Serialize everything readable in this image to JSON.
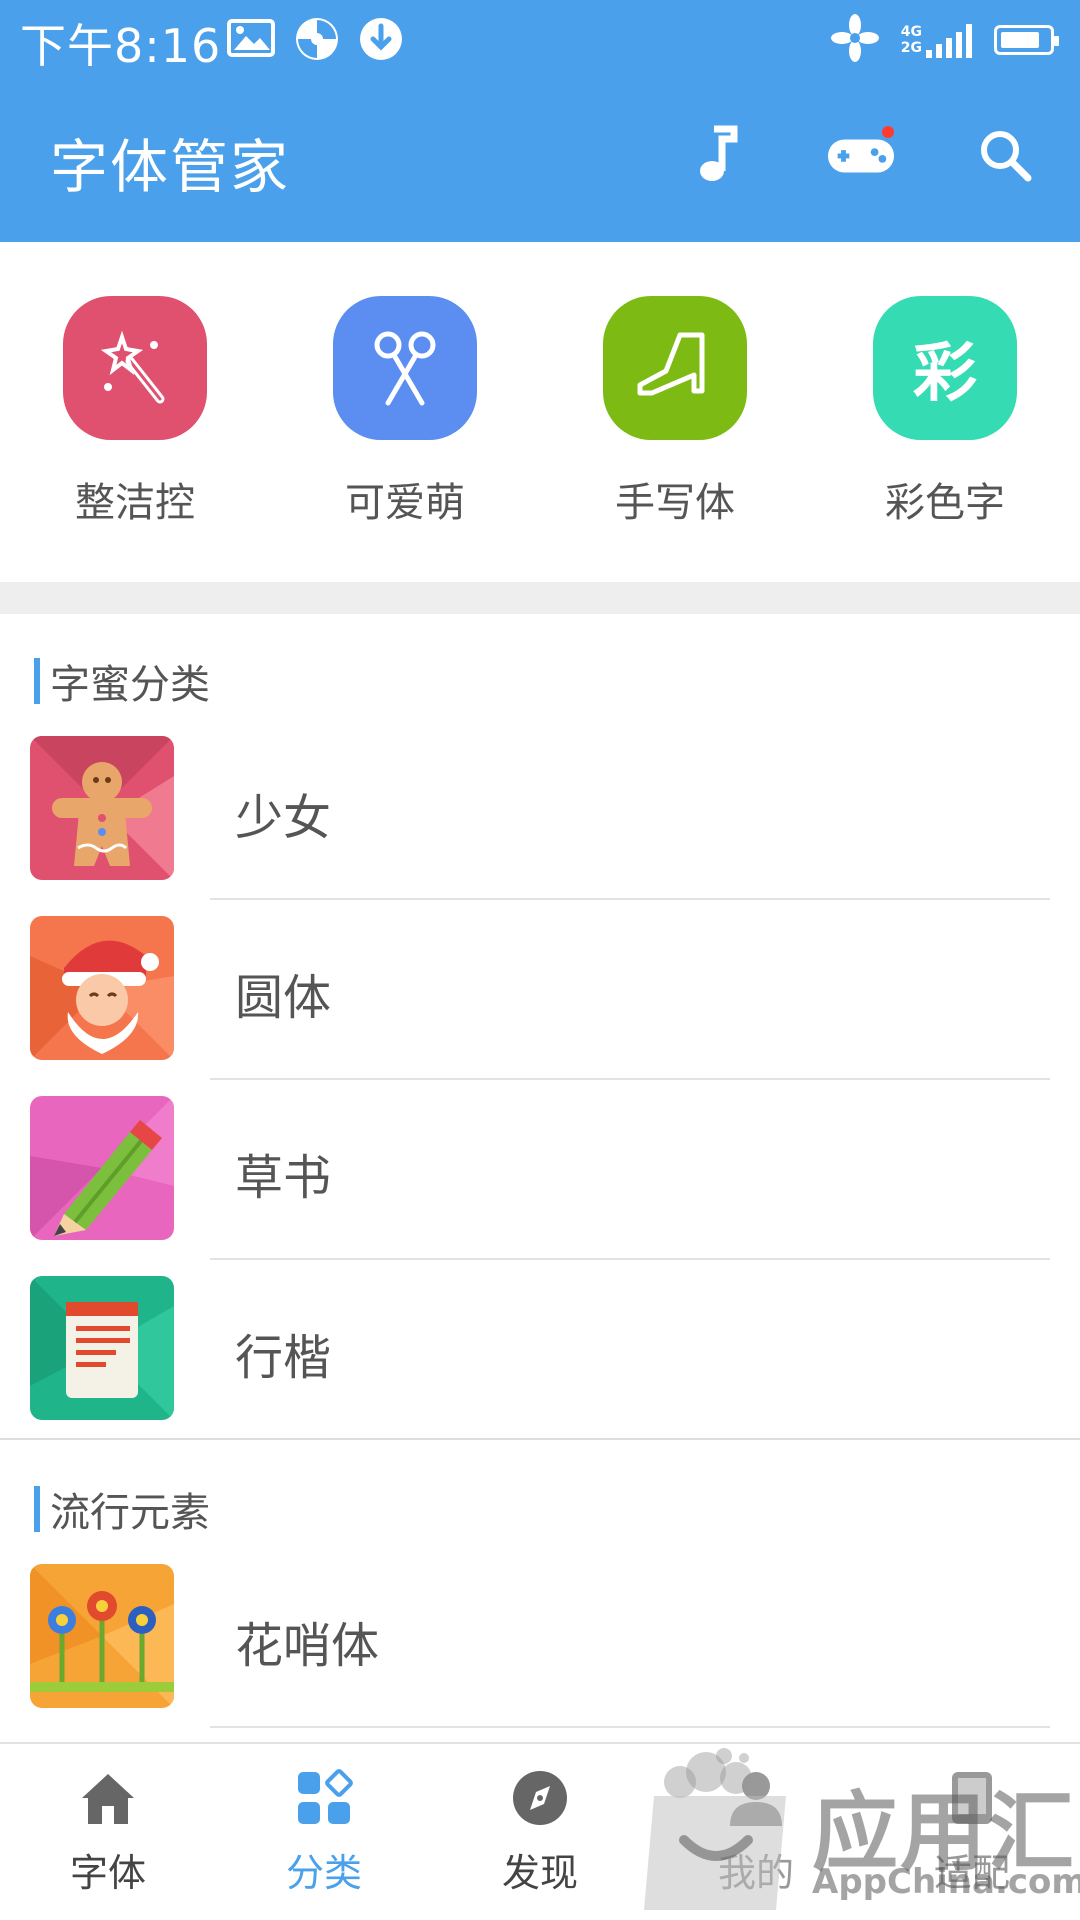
{
  "status_bar": {
    "time": "下午8:16",
    "network_top": "4G",
    "network_bottom": "2G"
  },
  "header": {
    "title": "字体管家",
    "icons": [
      "music-note-icon",
      "gamepad-icon",
      "search-icon"
    ]
  },
  "featured_categories": [
    {
      "label": "整洁控",
      "icon": "magic-wand-icon",
      "color": "#e0506f"
    },
    {
      "label": "可爱萌",
      "icon": "scissors-icon",
      "color": "#5b8ef0"
    },
    {
      "label": "手写体",
      "icon": "high-heel-icon",
      "color": "#7dbb14"
    },
    {
      "label": "彩色字",
      "icon": "colorful-char-icon",
      "icon_text": "彩",
      "color": "#35dbb2"
    }
  ],
  "sections": [
    {
      "title": "字蜜分类",
      "items": [
        {
          "label": "少女",
          "icon": "gingerbread-icon"
        },
        {
          "label": "圆体",
          "icon": "santa-icon"
        },
        {
          "label": "草书",
          "icon": "pencil-icon"
        },
        {
          "label": "行楷",
          "icon": "notepad-icon"
        }
      ]
    },
    {
      "title": "流行元素",
      "items": [
        {
          "label": "花哨体",
          "icon": "flowers-icon"
        }
      ]
    }
  ],
  "bottom_nav": [
    {
      "label": "字体",
      "icon": "home-icon",
      "active": false
    },
    {
      "label": "分类",
      "icon": "category-icon",
      "active": true
    },
    {
      "label": "发现",
      "icon": "compass-icon",
      "active": false
    },
    {
      "label": "我的",
      "icon": "user-icon",
      "active": false
    },
    {
      "label": "适配",
      "icon": "adapt-icon",
      "active": false
    }
  ],
  "watermark": {
    "cn": "应用汇",
    "en": "AppChina.com"
  },
  "colors": {
    "primary": "#4aa0ea",
    "background": "#ffffff",
    "band": "#eeeeee"
  }
}
